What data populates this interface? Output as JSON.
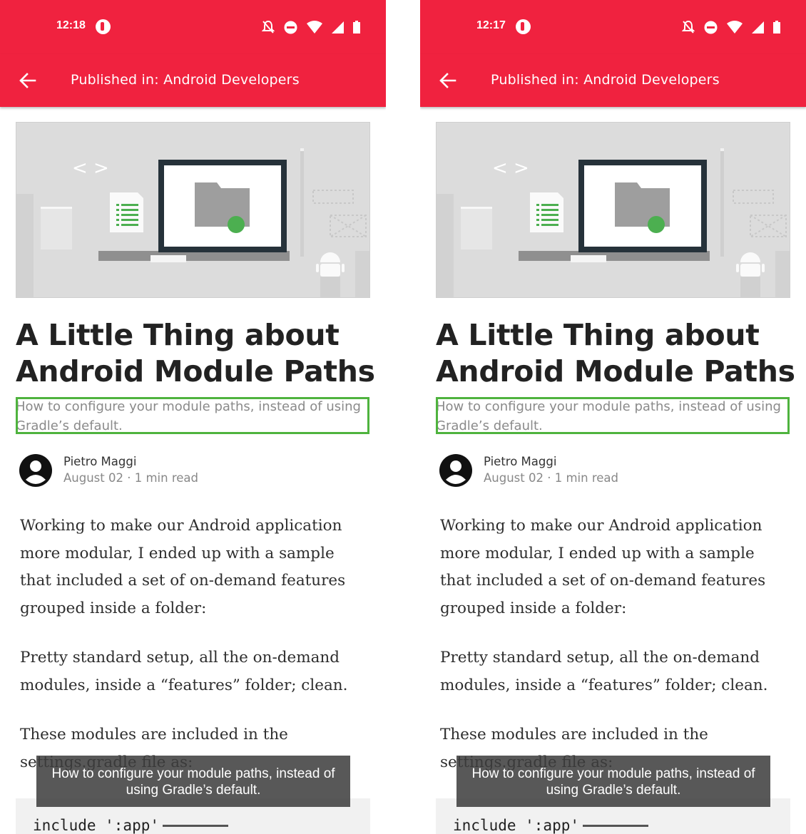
{
  "screens": [
    {
      "status_time": "12:18",
      "appbar_title": "Published in: Android Developers",
      "article_title": "A Little Thing about Android Module Paths",
      "subtitle": "How to configure your module paths, instead of using Gradle’s default.",
      "author_name": "Pietro Maggi",
      "author_meta": "August 02 · 1 min read",
      "paragraphs": [
        "Working to make our Android application more modular, I ended up with a sample that included a set of on-demand features grouped inside a folder:",
        "Pretty standard setup, all the on-demand modules, inside a “features” folder; clean.",
        "These modules are included in the settings.gradle file as:"
      ],
      "code_line": "include ':app'",
      "caption": "How to configure your module paths, instead of using Gradle’s default."
    },
    {
      "status_time": "12:17",
      "appbar_title": "Published in: Android Developers",
      "article_title": "A Little Thing about Android Module Paths",
      "subtitle": "How to configure your module paths, instead of using Gradle’s default.",
      "author_name": "Pietro Maggi",
      "author_meta": "August 02 · 1 min read",
      "paragraphs": [
        "Working to make our Android application more modular, I ended up with a sample that included a set of on-demand features grouped inside a folder:",
        "Pretty standard setup, all the on-demand modules, inside a “features” folder; clean.",
        "These modules are included in the settings.gradle file as:"
      ],
      "code_line": "include ':app'",
      "caption": "How to configure your module paths, instead of using Gradle’s default."
    }
  ],
  "icons": {
    "status": [
      "app-notification-icon",
      "do-not-disturb-off-icon",
      "dnd-icon",
      "wifi-icon",
      "signal-icon",
      "battery-icon"
    ],
    "appbar": "back-arrow-icon",
    "author": "account-circle-icon"
  },
  "colors": {
    "brand_red": "#f0223f",
    "highlight_green": "#4fb33e",
    "folder_dot_green": "#4caf50"
  }
}
